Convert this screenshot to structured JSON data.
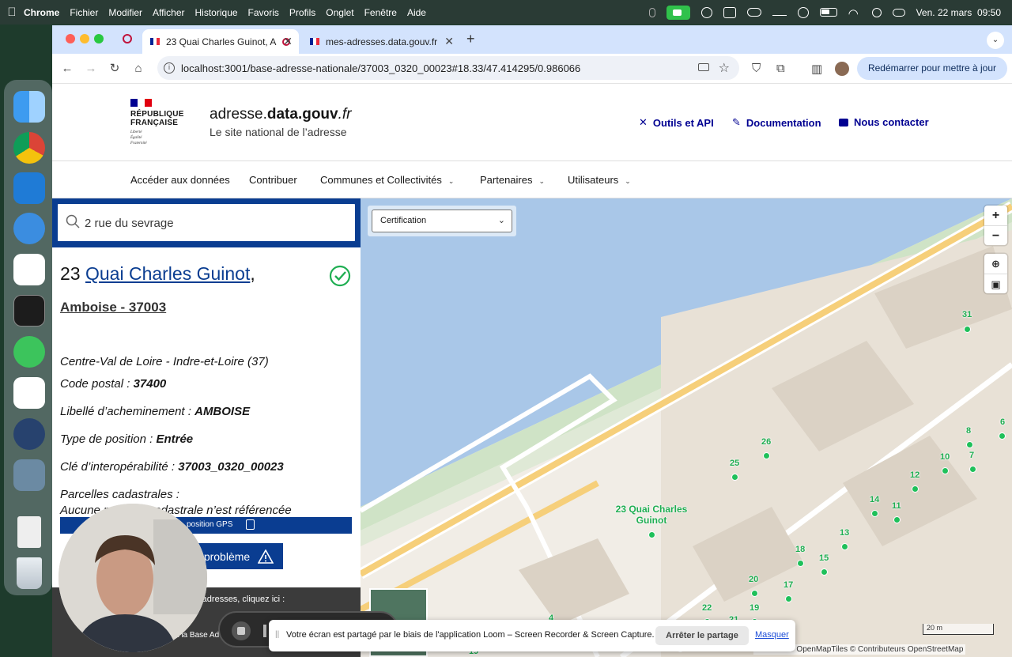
{
  "menubar": {
    "app": "Chrome",
    "items": [
      "Fichier",
      "Modifier",
      "Afficher",
      "Historique",
      "Favoris",
      "Profils",
      "Onglet",
      "Fenêtre",
      "Aide"
    ],
    "datetime": "Ven. 22 mars  09:50"
  },
  "browser": {
    "tabs": [
      {
        "title": "23 Quai Charles Guinot, A"
      },
      {
        "title": "mes-adresses.data.gouv.fr"
      }
    ],
    "url": "localhost:3001/base-adresse-nationale/37003_0320_00023#18.33/47.414295/0.986066",
    "relaunch_label": "Redémarrer pour mettre à jour"
  },
  "header": {
    "logo_lines": [
      "RÉPUBLIQUE",
      "FRANÇAISE"
    ],
    "logo_motto": [
      "Liberté",
      "Égalité",
      "Fraternité"
    ],
    "site_name_pre": "adresse.",
    "site_name_bold": "data.gouv",
    "site_name_post": ".fr",
    "tagline": "Le site national de l’adresse",
    "links": [
      "Outils et API",
      "Documentation",
      "Nous contacter"
    ]
  },
  "nav": {
    "items": [
      "Accéder aux données",
      "Contribuer",
      "Communes et Collectivités",
      "Partenaires",
      "Utilisateurs"
    ]
  },
  "sidebar": {
    "search_value": "2 rue du sevrage",
    "number": "23",
    "street": "Quai Charles Guinot",
    "comma": ",",
    "city": "Amboise - 37003",
    "region": "Centre-Val de Loire - Indre-et-Loire (37)",
    "postal_label": "Code postal : ",
    "postal_value": "37400",
    "routing_label": "Libellé d’acheminement : ",
    "routing_value": "AMBOISE",
    "position_label": "Type de position : ",
    "position_value": "Entrée",
    "key_label": "Clé d’interopérabilité : ",
    "key_value": "37003_0320_00023",
    "parcels_label": "Parcelles cadastrales :",
    "parcels_value": "Aucune parcelle cadastrale n’est référencée",
    "gps_label": "position GPS",
    "report_label": "problème",
    "footer_line1": "os adresses, cliquez ici :",
    "footer_line2": "a la Base Ad"
  },
  "map": {
    "filter_value": "Certification",
    "selected_label": "23 Quai Charles Guinot",
    "labels": [
      "31",
      "8",
      "6",
      "26",
      "10",
      "7",
      "25",
      "12",
      "14",
      "11",
      "13",
      "18",
      "15",
      "20",
      "17",
      "22",
      "19",
      "21",
      "24",
      "26",
      "4",
      "19"
    ],
    "scale": "20 m",
    "attribution": "© Etalab  © OpenMapTiles  © Contributeurs OpenStreetMap"
  },
  "share_banner": {
    "message": "Votre écran est partagé par le biais de l'application Loom – Screen Recorder & Screen Capture.",
    "stop_label": "Arrêter le partage",
    "hide_label": "Masquer"
  },
  "colors": {
    "dsfr_blue": "#000091",
    "sidebar_blue": "#0a3d91",
    "map_dot": "#1fc05a",
    "water": "#a9c7e8"
  }
}
